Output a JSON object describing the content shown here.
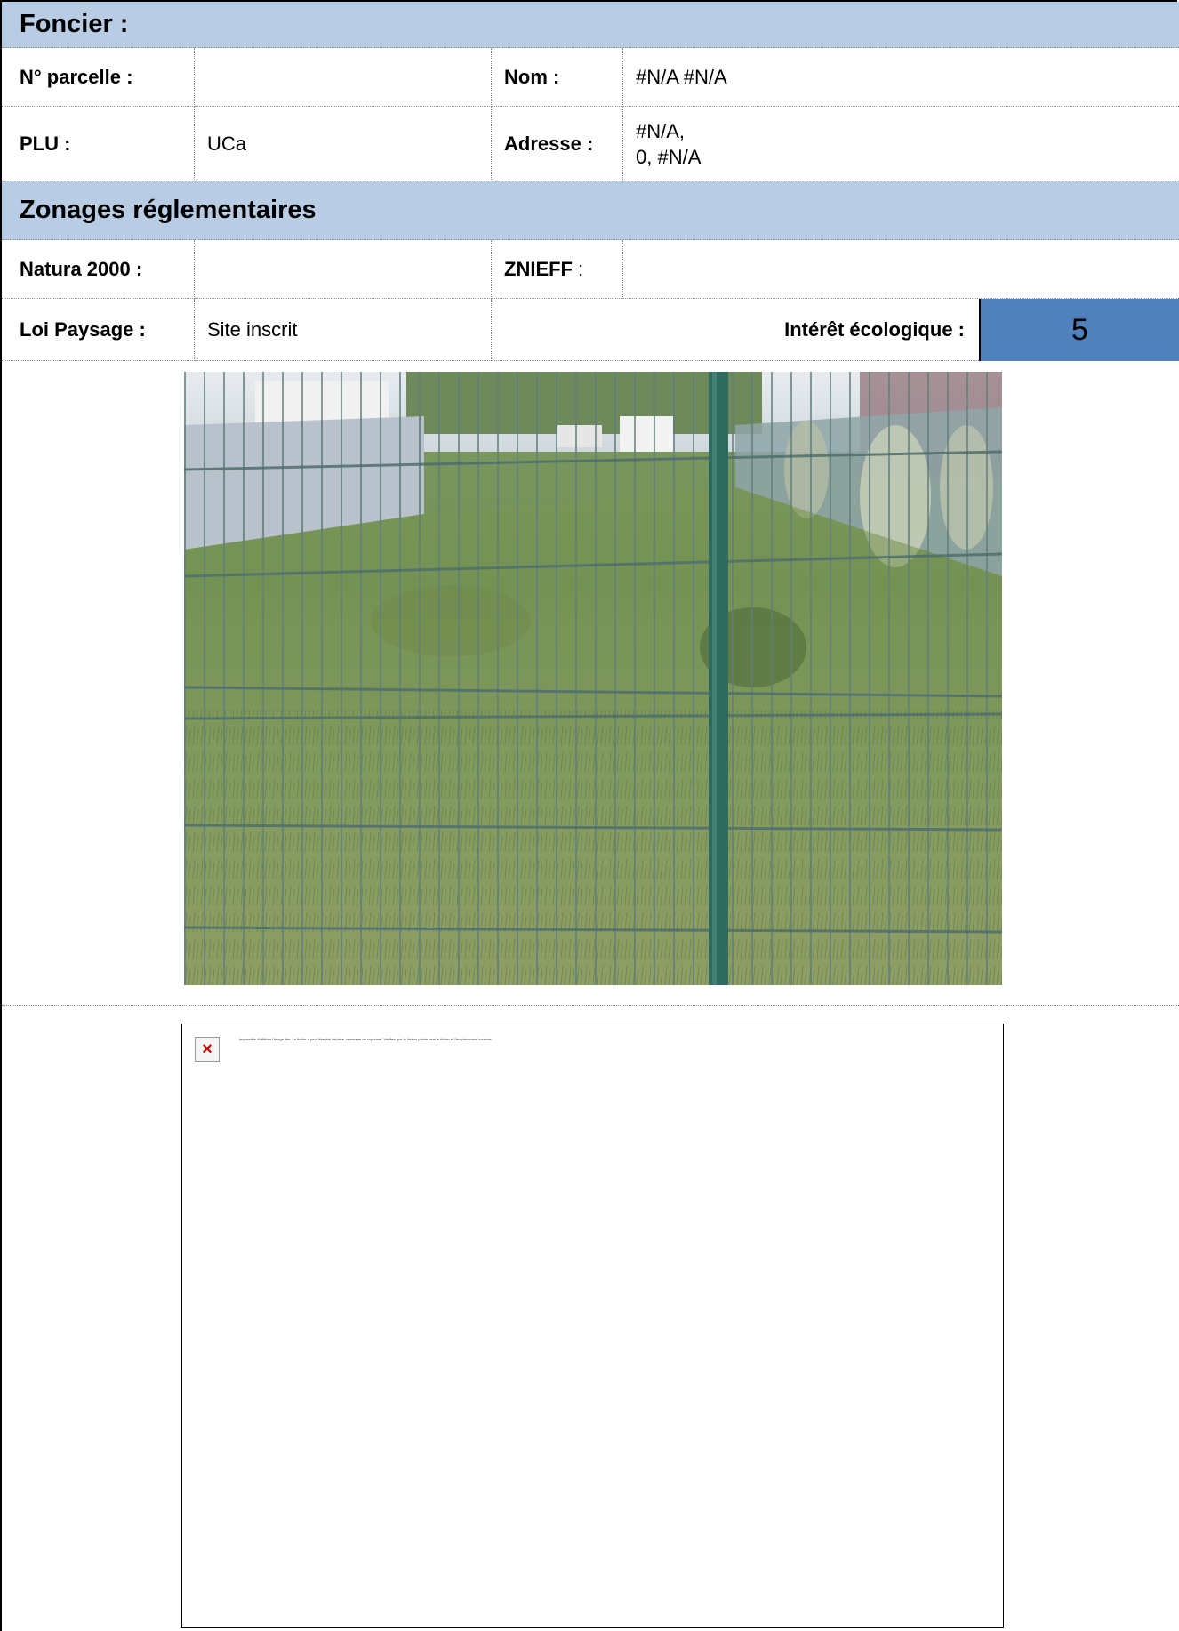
{
  "sections": {
    "foncier_title": "Foncier :",
    "zonages_title": "Zonages réglementaires"
  },
  "foncier": {
    "parcelle_label": "N° parcelle :",
    "parcelle_value": "",
    "nom_label": "Nom :",
    "nom_value": "#N/A #N/A",
    "plu_label": "PLU :",
    "plu_value": "UCa",
    "adresse_label": "Adresse :",
    "adresse_line1": "#N/A,",
    "adresse_line2": "0, #N/A"
  },
  "zonages": {
    "natura_label": "Natura 2000 :",
    "natura_value": "",
    "znieff_label": "ZNIEFF",
    "znieff_suffix": " :",
    "znieff_value": "",
    "loi_label": "Loi Paysage :",
    "loi_value": "Site inscrit",
    "interet_label": "Intérêt écologique :",
    "interet_value": "5"
  },
  "colors": {
    "header_bg": "#b8cce4",
    "score_bg": "#4f81bd",
    "broken_x": "#d00000"
  },
  "broken_image": {
    "icon": "broken-image-icon",
    "message": "Impossible d'afficher l'image liée. Le fichier a peut-être été déplacé, renommé ou supprimé. Vérifiez que la liaison pointe vers le fichier et l'emplacement corrects."
  }
}
